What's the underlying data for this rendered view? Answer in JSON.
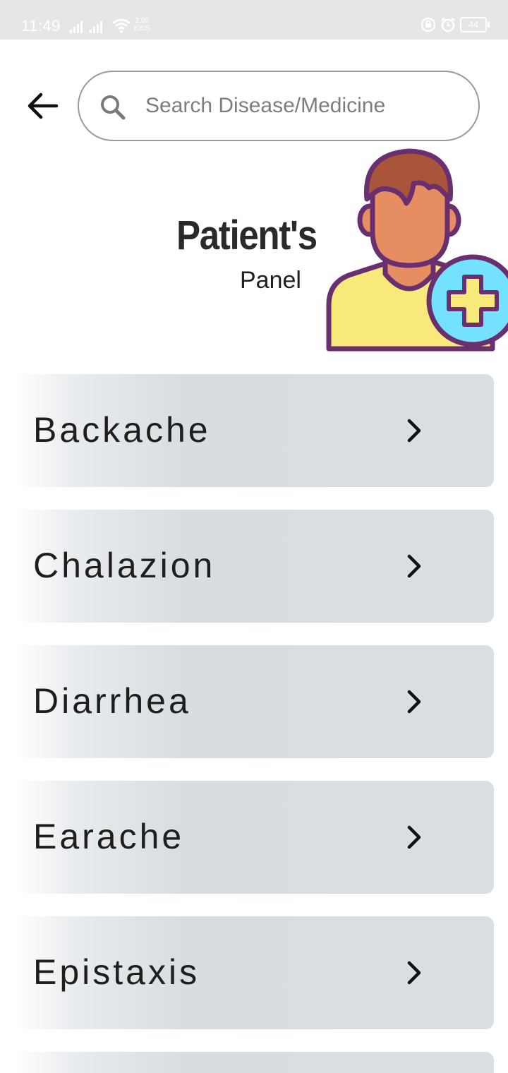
{
  "status_bar": {
    "time": "11:49",
    "net_speed_value": "2.00",
    "net_speed_unit": "KB/S",
    "battery": "44"
  },
  "search": {
    "placeholder": "Search Disease/Medicine",
    "value": ""
  },
  "panel": {
    "title": "Patient's",
    "subtitle": "Panel"
  },
  "colors": {
    "avatar_hair": "#a8553a",
    "avatar_skin": "#e68e62",
    "avatar_shirt": "#f7e97a",
    "avatar_outline": "#6a2f6e",
    "plus_circle": "#74e2ff",
    "plus_sign": "#f7e97a"
  },
  "diseases": [
    {
      "name": "Backache",
      "icon": "chevron-right-icon"
    },
    {
      "name": "Chalazion",
      "icon": "chevron-right-icon"
    },
    {
      "name": "Diarrhea",
      "icon": "chevron-right-icon"
    },
    {
      "name": "Earache",
      "icon": "chevron-right-icon"
    },
    {
      "name": "Epistaxis",
      "icon": "chevron-right-icon"
    },
    {
      "name": "",
      "icon": ""
    }
  ]
}
